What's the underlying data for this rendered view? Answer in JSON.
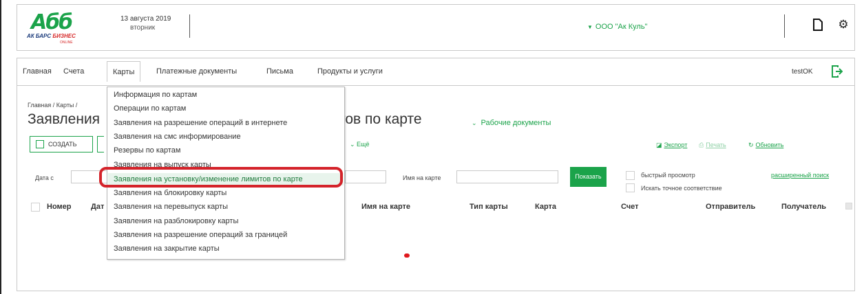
{
  "header": {
    "logo_main": "Абб",
    "logo_bank": "АК БАРС",
    "logo_biz": "БИЗНЕС",
    "logo_online": "ONLINE",
    "date": "13 августа 2019",
    "weekday": "вторник",
    "organization": "ООО \"Ак Куль\"",
    "icons": {
      "document": "document-icon",
      "settings": "gear-icon"
    }
  },
  "nav": {
    "items": [
      "Главная",
      "Счета",
      "Карты",
      "Платежные документы",
      "Письма",
      "Продукты и услуги"
    ],
    "active": "Карты",
    "user": "testOK",
    "logout_icon": "logout-icon"
  },
  "page": {
    "breadcrumb": "Главная / Карты /",
    "title_start": "Заявления",
    "title_end": "тов по карте",
    "work_docs": "Рабочие документы",
    "create_label": "СОЗДАТЬ",
    "more_label": "Ещё",
    "export_label": "Экспорт",
    "print_label": "Печать",
    "refresh_label": "Обновить"
  },
  "filters": {
    "date_from_label": "Дата с",
    "card_name_label": "Имя на карте",
    "show_button": "Показать",
    "quick_view_label": "быстрый просмотр",
    "exact_match_label": "Искать точное соответствие",
    "advanced_search": "расширенный поиск"
  },
  "table": {
    "columns": [
      "Номер",
      "Дат",
      "Имя на карте",
      "Тип карты",
      "Карта",
      "Счет",
      "Отправитель",
      "Получатель"
    ]
  },
  "dropdown": {
    "items": [
      "Информация по картам",
      "Операции по картам",
      "Заявления на разрешение операций в интернете",
      "Заявления на смс информирование",
      "Резервы по картам",
      "Заявления на выпуск карты",
      "Заявления на установку/изменение лимитов по карте",
      "Заявления на блокировку карты",
      "Заявления на перевыпуск карты",
      "Заявления на разблокировку карты",
      "Заявления на разрешение операций за границей",
      "Заявления на закрытие карты"
    ],
    "highlighted_index": 6
  },
  "colors": {
    "accent": "#1ba34a",
    "highlight_ring": "#d4232a"
  }
}
